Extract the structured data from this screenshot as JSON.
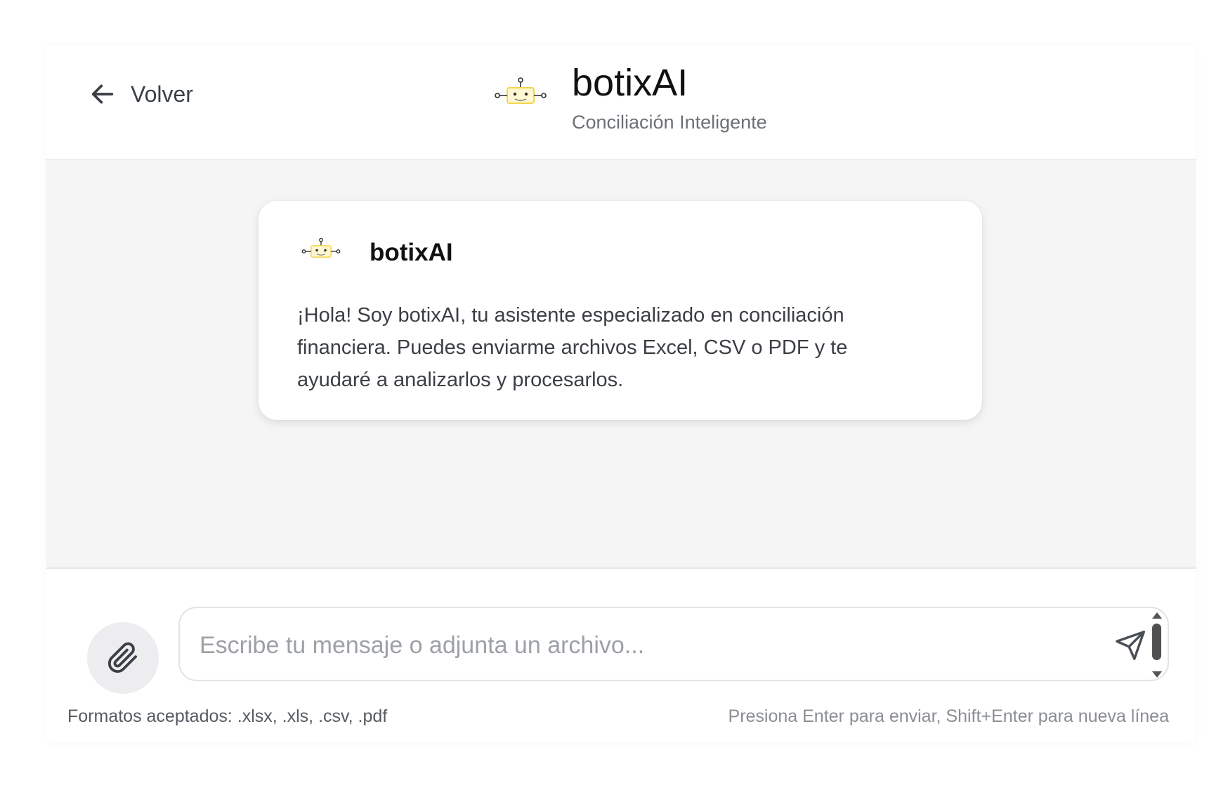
{
  "header": {
    "back_label": "Volver",
    "brand_title": "botixAI",
    "brand_subtitle": "Conciliación Inteligente"
  },
  "chat": {
    "messages": [
      {
        "sender": "botixAI",
        "text": "¡Hola! Soy botixAI, tu asistente especializado en conciliación financiera. Puedes enviarme archivos Excel, CSV o PDF y te ayudaré a analizarlos y procesarlos."
      }
    ]
  },
  "composer": {
    "placeholder": "Escribe tu mensaje o adjunta un archivo...",
    "accepted_formats": "Formatos aceptados: .xlsx, .xls, .csv, .pdf",
    "shortcut_hint": "Presiona Enter para enviar, Shift+Enter para nueva línea"
  },
  "icons": {
    "back": "arrow-left-icon",
    "logo": "robot-logo-icon",
    "attach": "paperclip-icon",
    "send": "send-icon"
  },
  "colors": {
    "chat_background": "#f5f5f6",
    "logo_accent": "#f2d64b",
    "attach_background": "#ededef"
  }
}
